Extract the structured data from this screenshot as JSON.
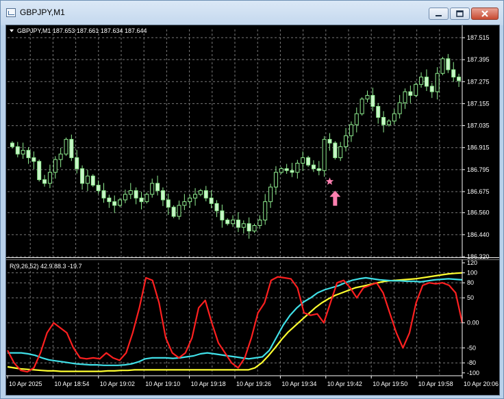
{
  "window": {
    "title": "GBPJPY,M1",
    "controls": {
      "minimize_icon": "minimize-icon",
      "maximize_icon": "maximize-icon",
      "close_icon": "close-icon"
    }
  },
  "colors": {
    "background": "#000000",
    "grid": "#7a7a7a",
    "candle_body": "#c8f5c8",
    "candle_wick": "#90ee90",
    "axis_text": "#ffffff",
    "rsi_line": "#ff2020",
    "cyan_line": "#40e0e8",
    "yellow_line": "#ffff30",
    "arrow": "#ff80b0"
  },
  "chart_data": [
    {
      "type": "candlestick",
      "header": "GBPJPY,M1  187.653 187.661 187.634 187.644",
      "ylim": [
        186.32,
        187.56
      ],
      "y_ticks": [
        187.515,
        187.395,
        187.275,
        187.155,
        187.035,
        186.915,
        186.795,
        186.675,
        186.56,
        186.44,
        186.32
      ],
      "y_tick_labels": [
        "187.515",
        "187.395",
        "187.275",
        "187.155",
        "187.035",
        "186.915",
        "186.795",
        "186.675",
        "186.560",
        "186.440",
        "186.320"
      ],
      "x_tick_labels": [
        "10 Apr 2025",
        "10 Apr 18:54",
        "10 Apr 19:02",
        "10 Apr 19:10",
        "10 Apr 19:18",
        "10 Apr 19:26",
        "10 Apr 19:34",
        "10 Apr 19:42",
        "10 Apr 19:50",
        "10 Apr 19:58",
        "10 Apr 20:06"
      ],
      "close_path": [
        186.92,
        186.88,
        186.9,
        186.86,
        186.84,
        186.74,
        186.72,
        186.78,
        186.85,
        186.88,
        186.96,
        186.86,
        186.8,
        186.72,
        186.76,
        186.71,
        186.68,
        186.64,
        186.62,
        186.6,
        186.63,
        186.66,
        186.68,
        186.64,
        186.62,
        186.66,
        186.72,
        186.68,
        186.63,
        186.59,
        186.54,
        186.6,
        186.62,
        186.64,
        186.66,
        186.68,
        186.64,
        186.61,
        186.57,
        186.52,
        186.5,
        186.52,
        186.48,
        186.5,
        186.46,
        186.49,
        186.52,
        186.62,
        186.7,
        186.78,
        186.8,
        186.79,
        186.78,
        186.83,
        186.86,
        186.82,
        186.8,
        186.79,
        186.96,
        186.94,
        186.86,
        186.92,
        186.98,
        187.04,
        187.1,
        187.18,
        187.2,
        187.14,
        187.08,
        187.04,
        187.06,
        187.1,
        187.16,
        187.22,
        187.2,
        187.26,
        187.3,
        187.25,
        187.22,
        187.32,
        187.4,
        187.34,
        187.3,
        187.28
      ],
      "markers": [
        {
          "kind": "star",
          "price": 186.73,
          "bar_index": 59
        },
        {
          "kind": "up-arrow",
          "price": 186.68,
          "bar_index": 60
        }
      ]
    },
    {
      "type": "line",
      "header": "R(9,26,52) 42.9 88.3 -19.7",
      "ylim": [
        -103,
        120
      ],
      "y_ticks": [
        120,
        100,
        80,
        50,
        0.0,
        -50,
        -80,
        -100
      ],
      "y_tick_labels": [
        "120",
        "100",
        "80",
        "50",
        "0.00",
        "-50",
        "-80",
        "-100"
      ],
      "series": [
        {
          "color": "red",
          "values": [
            -55,
            -80,
            -95,
            -98,
            -90,
            -60,
            -20,
            0,
            -10,
            -20,
            -50,
            -70,
            -72,
            -70,
            -72,
            -60,
            -70,
            -75,
            -60,
            -20,
            30,
            90,
            85,
            40,
            -30,
            -60,
            -70,
            -60,
            -30,
            30,
            45,
            0,
            -40,
            -60,
            -80,
            -90,
            -70,
            -30,
            20,
            40,
            85,
            92,
            90,
            88,
            70,
            20,
            15,
            18,
            0,
            40,
            80,
            85,
            70,
            50,
            70,
            75,
            80,
            60,
            20,
            -20,
            -50,
            -20,
            40,
            75,
            80,
            78,
            80,
            75,
            60,
            0
          ]
        },
        {
          "color": "cyan",
          "values": [
            -60,
            -60,
            -60,
            -62,
            -65,
            -70,
            -74,
            -76,
            -78,
            -80,
            -82,
            -83,
            -84,
            -84,
            -85,
            -85,
            -85,
            -84,
            -82,
            -78,
            -72,
            -70,
            -70,
            -70,
            -71,
            -70,
            -68,
            -66,
            -62,
            -60,
            -62,
            -64,
            -66,
            -68,
            -70,
            -72,
            -70,
            -68,
            -55,
            -30,
            -5,
            15,
            30,
            42,
            50,
            60,
            66,
            70,
            74,
            80,
            85,
            88,
            90,
            88,
            86,
            85,
            84,
            84,
            83,
            83,
            82,
            84,
            86,
            87,
            88,
            87,
            86
          ]
        },
        {
          "color": "yellow",
          "values": [
            -88,
            -90,
            -92,
            -93,
            -94,
            -95,
            -96,
            -96,
            -97,
            -97,
            -97,
            -97,
            -97,
            -97,
            -97,
            -96,
            -96,
            -95,
            -95,
            -94,
            -94,
            -94,
            -94,
            -94,
            -94,
            -94,
            -94,
            -94,
            -94,
            -94,
            -94,
            -94,
            -94,
            -94,
            -94,
            -94,
            -94,
            -90,
            -80,
            -66,
            -50,
            -33,
            -18,
            -6,
            6,
            18,
            30,
            40,
            48,
            55,
            60,
            65,
            70,
            73,
            76,
            79,
            82,
            84,
            85,
            86,
            87,
            88,
            90,
            92,
            94,
            96,
            98,
            99,
            100
          ]
        }
      ]
    }
  ]
}
